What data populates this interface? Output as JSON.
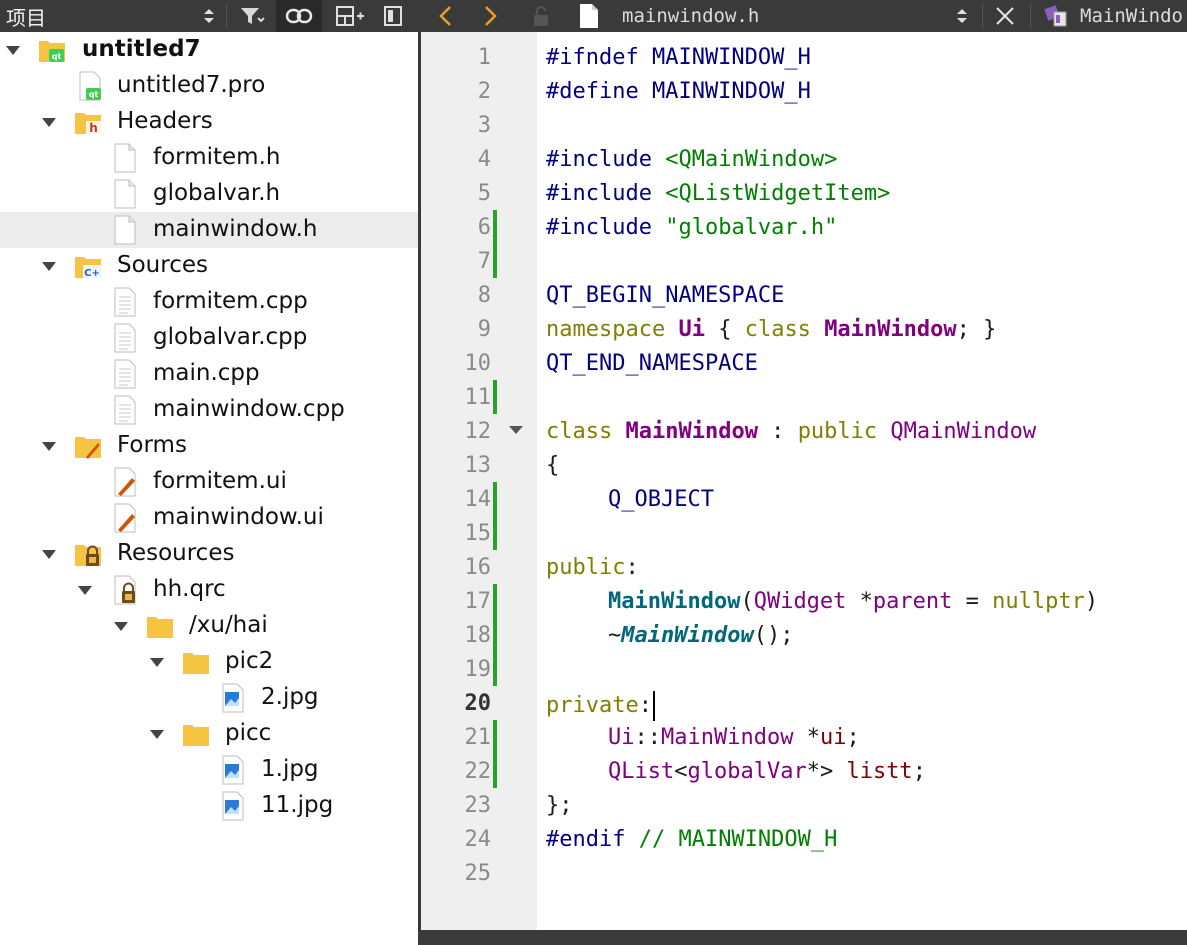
{
  "panel": {
    "title": "项目"
  },
  "editor_tab": {
    "file_name": "mainwindow.h",
    "symbol": "MainWindo"
  },
  "tree": {
    "project": "untitled7",
    "pro_file": "untitled7.pro",
    "headers": "Headers",
    "header_files": [
      "formitem.h",
      "globalvar.h",
      "mainwindow.h"
    ],
    "sources": "Sources",
    "source_files": [
      "formitem.cpp",
      "globalvar.cpp",
      "main.cpp",
      "mainwindow.cpp"
    ],
    "forms": "Forms",
    "form_files": [
      "formitem.ui",
      "mainwindow.ui"
    ],
    "resources": "Resources",
    "qrc": "hh.qrc",
    "prefix": "/xu/hai",
    "folder1": "pic2",
    "folder1_files": [
      "2.jpg"
    ],
    "folder2": "picc",
    "folder2_files": [
      "1.jpg",
      "11.jpg"
    ]
  },
  "editor": {
    "line_numbers": [
      "1",
      "2",
      "3",
      "4",
      "5",
      "6",
      "7",
      "8",
      "9",
      "10",
      "11",
      "12",
      "13",
      "14",
      "15",
      "16",
      "17",
      "18",
      "19",
      "20",
      "21",
      "22",
      "23",
      "24",
      "25"
    ],
    "current_line": "20",
    "code": {
      "l1a": "#ifndef MAINWINDOW_H",
      "l2a": "#define MAINWINDOW_H",
      "l4a": "#include ",
      "l4b": "<QMainWindow>",
      "l5a": "#include ",
      "l5b": "<QListWidgetItem>",
      "l6a": "#include ",
      "l6b": "\"globalvar.h\"",
      "l8a": "QT_BEGIN_NAMESPACE",
      "l9a": "namespace ",
      "l9b": "Ui",
      "l9c": " { ",
      "l9d": "class ",
      "l9e": "MainWindow",
      "l9f": "; }",
      "l10a": "QT_END_NAMESPACE",
      "l12a": "class ",
      "l12b": "MainWindow",
      "l12c": " : ",
      "l12d": "public ",
      "l12e": "QMainWindow",
      "l13a": "{",
      "l14a": "Q_OBJECT",
      "l16a": "public",
      "l16b": ":",
      "l17a": "MainWindow",
      "l17b": "(",
      "l17c": "QWidget",
      "l17d": " *",
      "l17e": "parent",
      "l17f": " = ",
      "l17g": "nullptr",
      "l17h": ")",
      "l18a": "~",
      "l18b": "MainWindow",
      "l18c": "();",
      "l20a": "private",
      "l20b": ":",
      "l21a": "Ui",
      "l21b": "::",
      "l21c": "MainWindow",
      "l21d": " *",
      "l21e": "ui",
      "l21f": ";",
      "l22a": "QList",
      "l22b": "<",
      "l22c": "globalVar",
      "l22d": "*> ",
      "l22e": "listt",
      "l22f": ";",
      "l23a": "};",
      "l24a": "#endif ",
      "l24b": "// MAINWINDOW_H"
    }
  }
}
